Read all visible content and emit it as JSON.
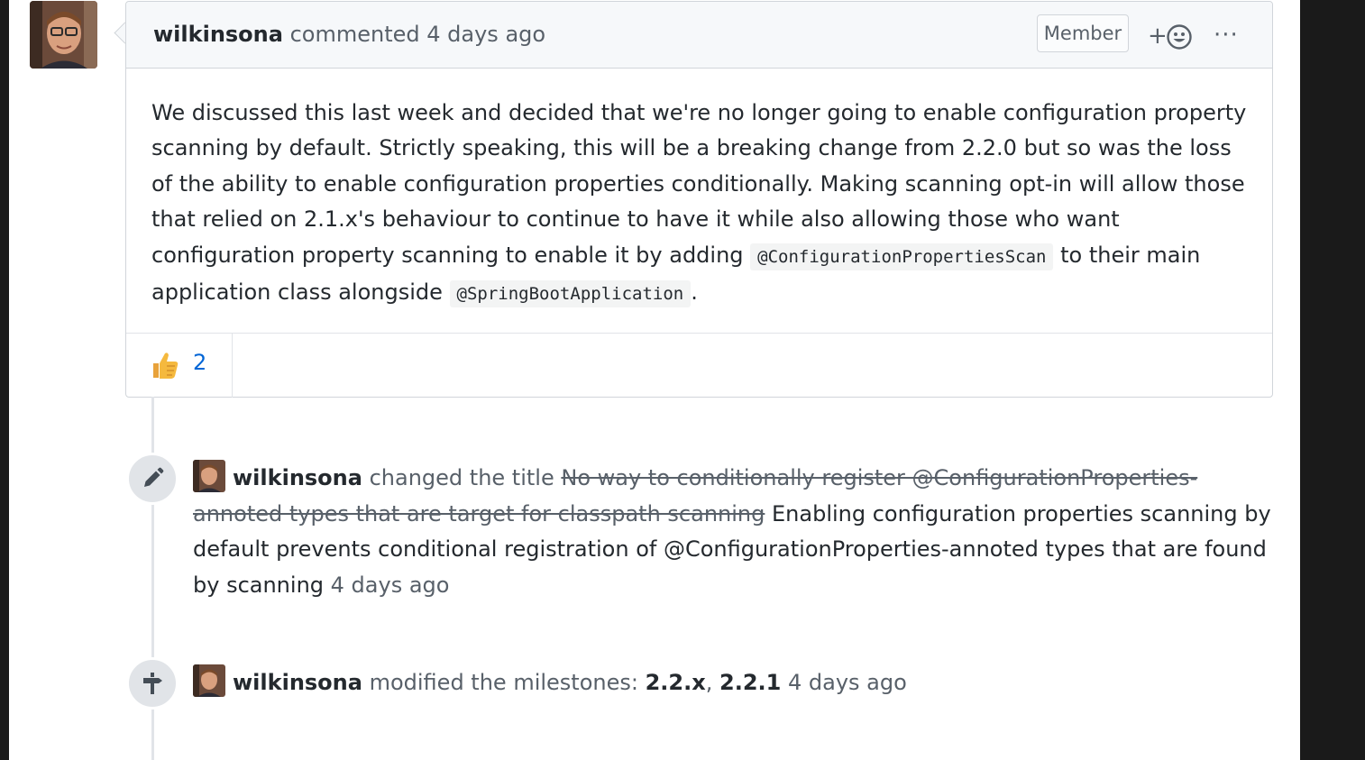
{
  "comment": {
    "author": "wilkinsona",
    "action": "commented",
    "time": "4 days ago",
    "role_badge": "Member",
    "add_reaction_label": "+",
    "more_label": "···",
    "body": {
      "text1": "We discussed this last week and decided that we're no longer going to enable configuration property scanning by default. Strictly speaking, this will be a breaking change from 2.2.0 but so was the loss of the ability to enable configuration properties conditionally. Making scanning opt-in will allow those that relied on 2.1.x's behaviour to continue to have it while also allowing those who want configuration property scanning to enable it by adding",
      "code1": "@ConfigurationPropertiesScan",
      "text2": "to their main application class alongside",
      "code2": "@SpringBootApplication",
      "text3": "."
    },
    "reactions": [
      {
        "icon": "thumbs-up-icon",
        "count": "2"
      }
    ]
  },
  "events": [
    {
      "icon": "pencil-icon",
      "author": "wilkinsona",
      "action": "changed the title",
      "old_title": "No way to conditionally register @ConfigurationProperties-annoted types that are target for classpath scanning",
      "new_title": "Enabling configuration properties scanning by default prevents conditional registration of @ConfigurationProperties-annoted types that are found by scanning",
      "time": "4 days ago"
    },
    {
      "icon": "milestone-icon",
      "author": "wilkinsona",
      "action": "modified the milestones:",
      "milestone1": "2.2.x",
      "separator": ",",
      "milestone2": "2.2.1",
      "time": "4 days ago"
    }
  ],
  "colors": {
    "link": "#0366d6",
    "header_bg": "#f6f8fa",
    "border": "#d1d5da",
    "muted": "#586069",
    "text": "#24292e"
  }
}
